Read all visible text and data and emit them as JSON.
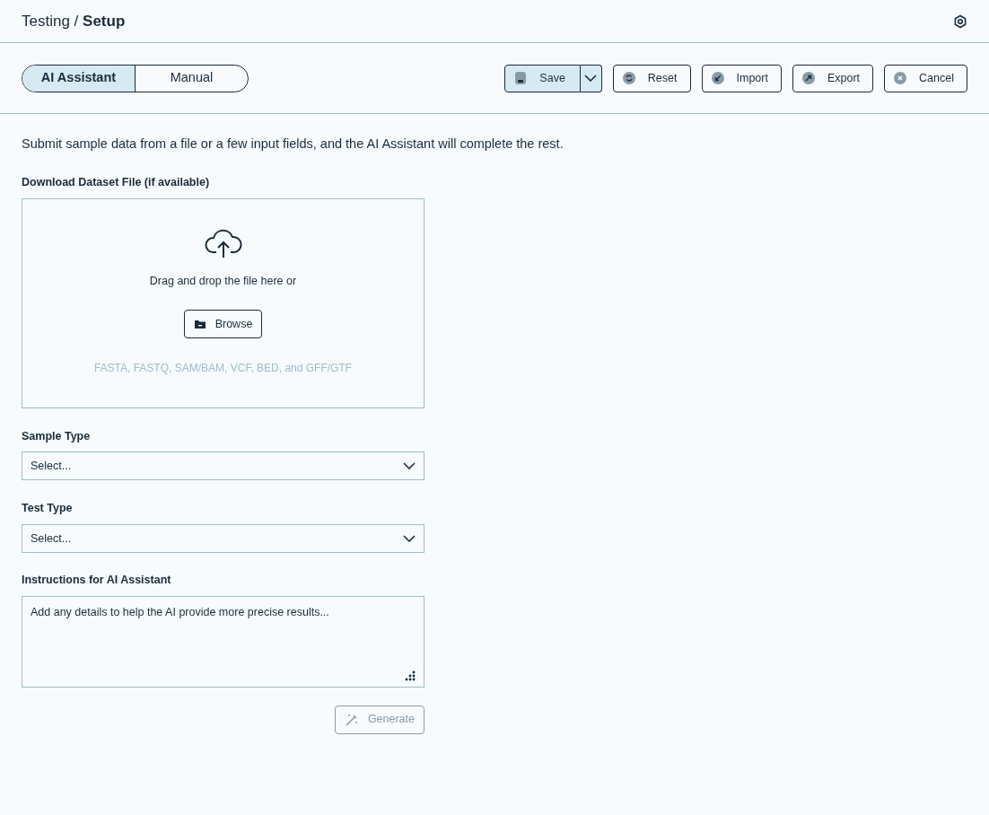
{
  "header": {
    "breadcrumb": "Testing / **Setup**"
  },
  "mode_tabs": [
    {
      "label": "AI Assistant",
      "selected": true
    },
    {
      "label": "Manual",
      "selected": false
    }
  ],
  "actions": [
    {
      "kind": "save",
      "label": "Save",
      "selected": true
    },
    {
      "kind": "reset",
      "label": "Reset",
      "selected": false
    },
    {
      "kind": "import",
      "label": "Import",
      "selected": false
    },
    {
      "kind": "export",
      "label": "Export",
      "selected": false
    },
    {
      "kind": "cancel",
      "label": "Cancel",
      "selected": false
    }
  ],
  "intro": "Submit sample data from a file or a few input fields, and the AI Assistant will complete the rest.",
  "upload": {
    "label": "Download Dataset File (if available)",
    "prompt": "Drag and drop the file here or",
    "browse": "Browse",
    "formats": "FASTA, FASTQ, SAM/BAM, VCF, BED, and GFF/GTF"
  },
  "selects": [
    {
      "label": "Sample Type",
      "placeholder": "Select..."
    },
    {
      "label": "Test Type",
      "placeholder": "Select..."
    }
  ],
  "instructions": {
    "label": "Instructions for AI Assistant",
    "placeholder": "Add any details to help the AI provide more precise results..."
  },
  "generate": {
    "label": "Generate",
    "disabled": true
  }
}
